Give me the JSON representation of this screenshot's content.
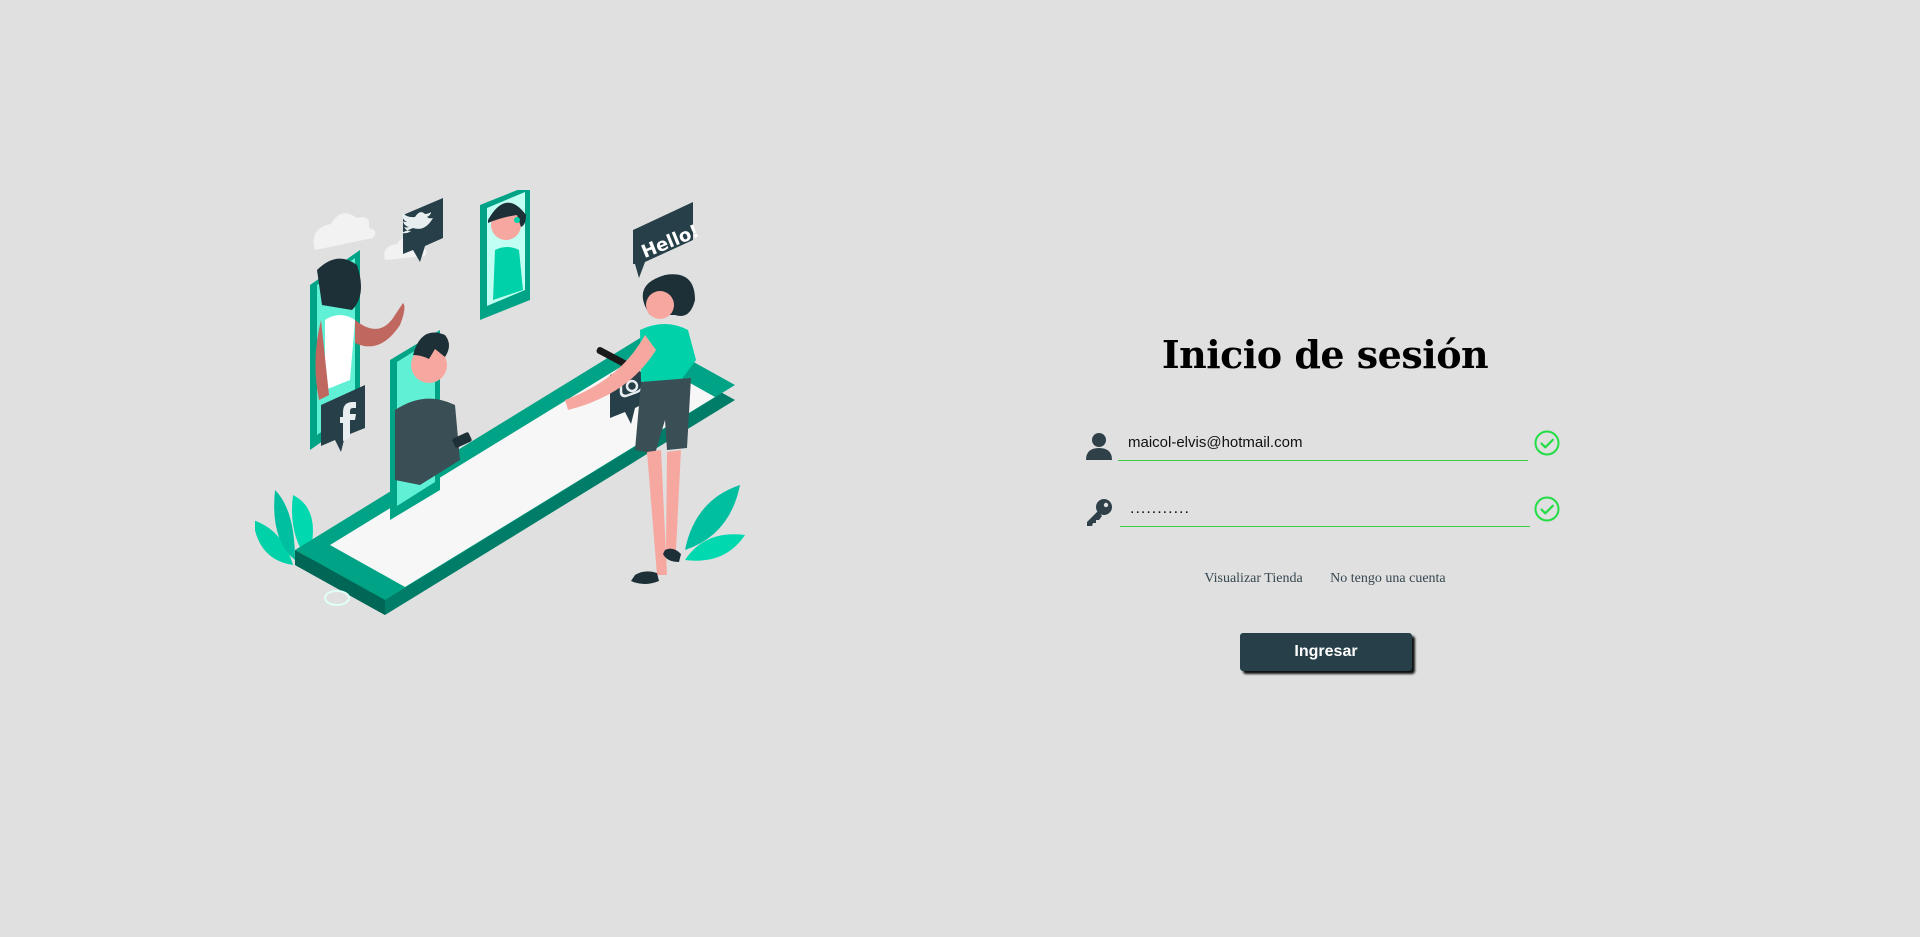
{
  "colors": {
    "background": "#e0e0e0",
    "accent_teal": "#00bfa0",
    "dark_slate": "#263f48",
    "valid_green": "#3ecf3e"
  },
  "illustration": {
    "hello_bubble": "Hello!",
    "icons": [
      "twitter-icon",
      "facebook-icon",
      "instagram-icon"
    ]
  },
  "login": {
    "title": "Inicio de sesión",
    "email": {
      "value": "maicol-elvis@hotmail.com",
      "icon": "user-icon",
      "status_icon": "check-circle-icon"
    },
    "password": {
      "value": "...........",
      "icon": "key-icon",
      "status_icon": "check-circle-icon"
    },
    "links": {
      "store": "Visualizar Tienda",
      "no_account": "No tengo una cuenta"
    },
    "submit_label": "Ingresar"
  }
}
